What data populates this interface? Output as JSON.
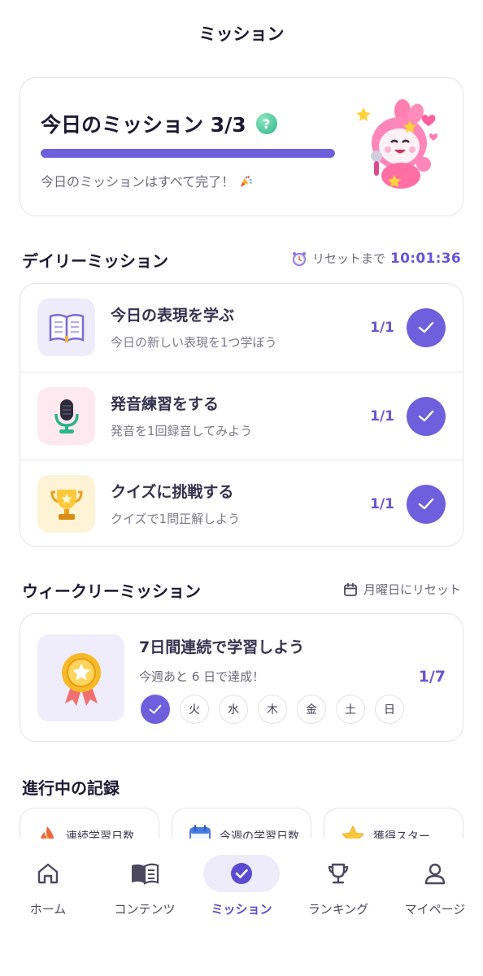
{
  "header": {
    "title": "ミッション"
  },
  "today": {
    "title": "今日のミッション 3/3",
    "progress": 1.0,
    "message": "今日のミッションはすべて完了！"
  },
  "daily": {
    "section_title": "デイリーミッション",
    "reset_label": "リセットまで",
    "reset_time": "10:01:36",
    "items": [
      {
        "title": "今日の表現を学ぶ",
        "desc": "今日の新しい表現を1つ学ぼう",
        "count": "1/1",
        "icon": "book-icon",
        "completed": true
      },
      {
        "title": "発音練習をする",
        "desc": "発音を1回録音してみよう",
        "count": "1/1",
        "icon": "microphone-icon",
        "completed": true
      },
      {
        "title": "クイズに挑戦する",
        "desc": "クイズで1問正解しよう",
        "count": "1/1",
        "icon": "trophy-icon",
        "completed": true
      }
    ]
  },
  "weekly": {
    "section_title": "ウィークリーミッション",
    "reset_label": "月曜日にリセット",
    "title": "7日間連続で学習しよう",
    "desc": "今週あと 6 日で達成！",
    "count": "1/7",
    "days": [
      {
        "label": "",
        "done": true
      },
      {
        "label": "火",
        "done": false
      },
      {
        "label": "水",
        "done": false
      },
      {
        "label": "木",
        "done": false
      },
      {
        "label": "金",
        "done": false
      },
      {
        "label": "土",
        "done": false
      },
      {
        "label": "日",
        "done": false
      }
    ]
  },
  "records": {
    "section_title": "進行中の記録",
    "items": [
      {
        "label": "連続学習日数",
        "icon": "flame-icon"
      },
      {
        "label": "今週の学習日数",
        "icon": "calendar-icon"
      },
      {
        "label": "獲得スター",
        "icon": "star-icon"
      }
    ]
  },
  "nav": {
    "items": [
      {
        "label": "ホーム",
        "icon": "home-icon"
      },
      {
        "label": "コンテンツ",
        "icon": "open-book-icon"
      },
      {
        "label": "ミッション",
        "icon": "check-circle-icon",
        "active": true
      },
      {
        "label": "ランキング",
        "icon": "trophy-icon"
      },
      {
        "label": "マイページ",
        "icon": "user-icon"
      }
    ]
  },
  "colors": {
    "accent": "#6e5fdc",
    "border": "#e3e3ec"
  }
}
